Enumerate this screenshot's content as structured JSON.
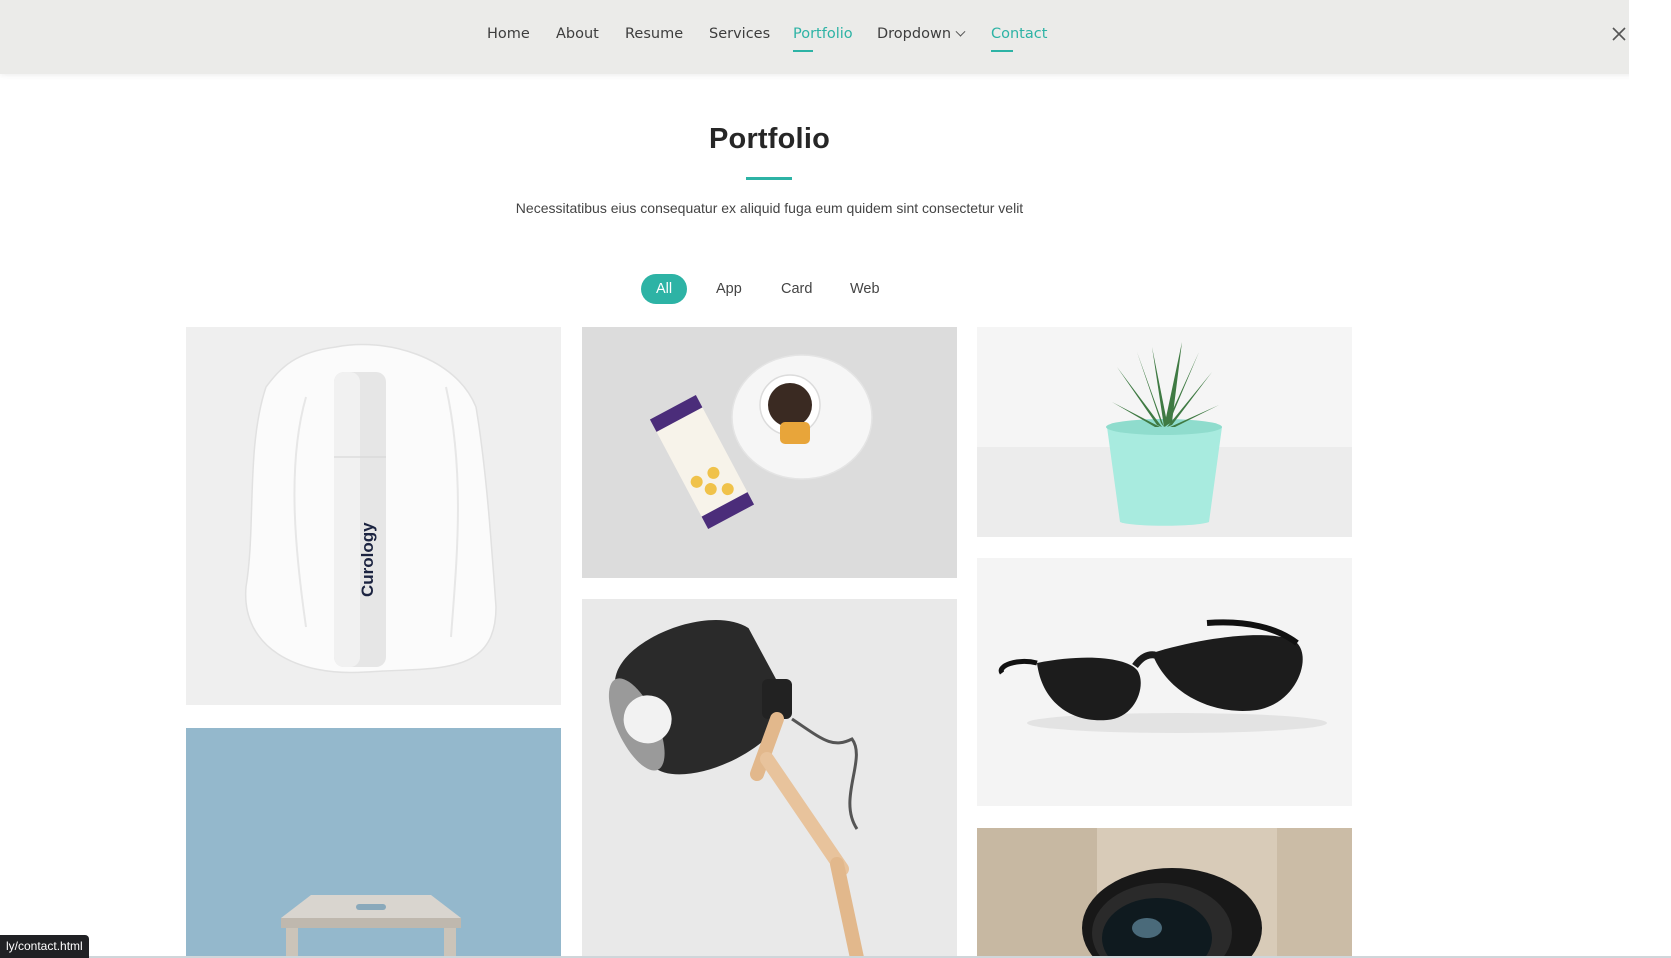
{
  "nav": {
    "items": [
      {
        "label": "Home"
      },
      {
        "label": "About"
      },
      {
        "label": "Resume"
      },
      {
        "label": "Services"
      },
      {
        "label": "Portfolio"
      },
      {
        "label": "Dropdown"
      },
      {
        "label": "Contact"
      }
    ]
  },
  "socials": [
    "x-icon",
    "facebook-icon",
    "instagram-icon"
  ],
  "section": {
    "title": "Portfolio",
    "subtitle": "Necessitatibus eius consequatur ex aliquid fuga eum quidem sint consectetur velit"
  },
  "filters": {
    "items": [
      {
        "label": "All"
      },
      {
        "label": "App"
      },
      {
        "label": "Card"
      },
      {
        "label": "Web"
      }
    ]
  },
  "portfolio": {
    "items": [
      {
        "name": "curology-bottle",
        "brand_text": "Curology"
      },
      {
        "name": "honeycomb-tea"
      },
      {
        "name": "succulent-plant"
      },
      {
        "name": "desk-lamp"
      },
      {
        "name": "sunglasses"
      },
      {
        "name": "wooden-stool"
      },
      {
        "name": "camera-lens"
      }
    ]
  },
  "status_bar": {
    "url": "ly/contact.html"
  },
  "colors": {
    "accent": "#2db3a5",
    "header_bg": "#ebebe9"
  }
}
